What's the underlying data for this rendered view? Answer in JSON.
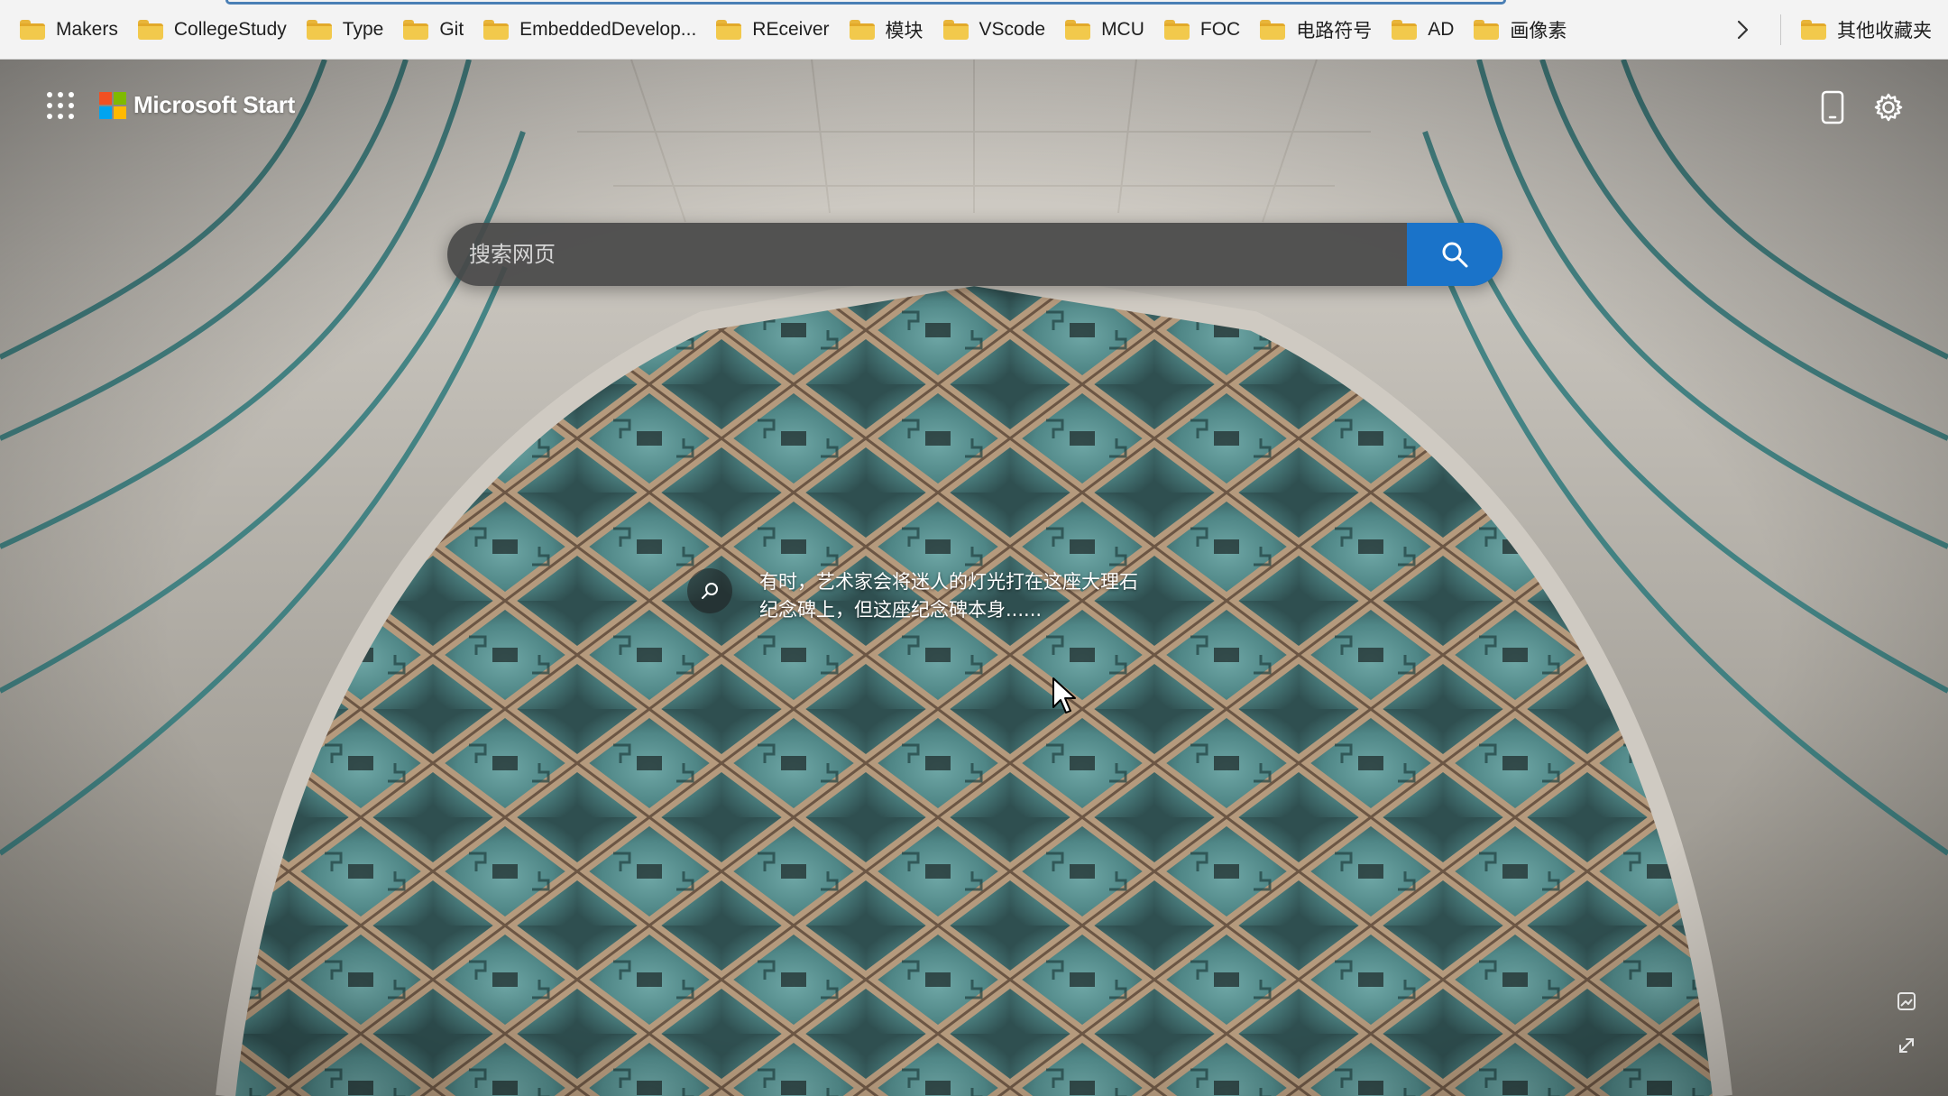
{
  "bookmarks": {
    "items": [
      {
        "label": "Makers"
      },
      {
        "label": "CollegeStudy"
      },
      {
        "label": "Type"
      },
      {
        "label": "Git"
      },
      {
        "label": "EmbeddedDevelop..."
      },
      {
        "label": "REceiver"
      },
      {
        "label": "模块"
      },
      {
        "label": "VScode"
      },
      {
        "label": "MCU"
      },
      {
        "label": "FOC"
      },
      {
        "label": "电路符号"
      },
      {
        "label": "AD"
      },
      {
        "label": "画像素"
      }
    ],
    "overflow_icon": "chevron-right-icon",
    "other_favorites": "其他收藏夹",
    "folder_color": "#f2c94c"
  },
  "header": {
    "brand": "Microsoft Start",
    "apps_icon": "apps-grid-icon",
    "mobile_icon": "phone-icon",
    "settings_icon": "gear-icon",
    "logo_colors": [
      "#f25022",
      "#7fba00",
      "#00a4ef",
      "#ffb900"
    ]
  },
  "search": {
    "placeholder": "搜索网页",
    "button_icon": "search-icon",
    "button_color": "#1a73c9"
  },
  "image_caption": {
    "icon": "image-search-icon",
    "text": "有时，艺术家会将迷人的灯光打在这座大理石纪念碑上，但这座纪念碑本身......"
  },
  "corner_tools": {
    "image_icon": "image-icon",
    "fullscreen_icon": "expand-icon"
  }
}
